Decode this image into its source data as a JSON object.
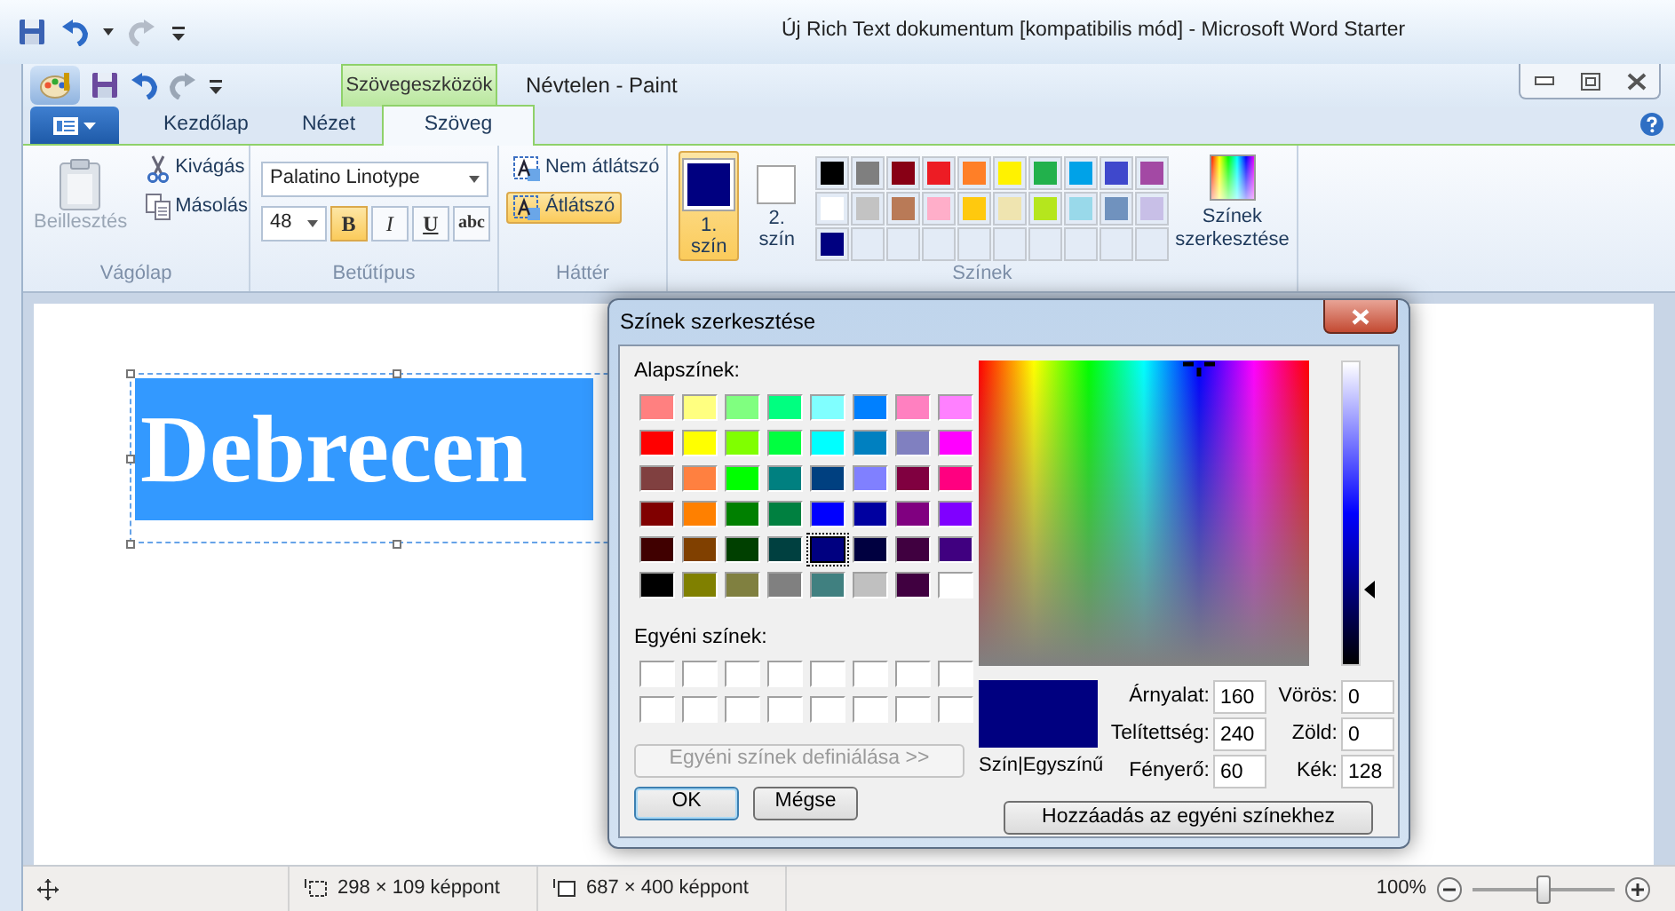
{
  "word_window": {
    "title": "Új Rich Text dokumentum [kompatibilis mód]  -  Microsoft Word Starter"
  },
  "paint_window": {
    "title": "Névtelen - Paint",
    "context_tab": "Szövegeszközök"
  },
  "ribbon_tabs": [
    {
      "label": "Kezdőlap",
      "selected": false
    },
    {
      "label": "Nézet",
      "selected": false
    },
    {
      "label": "Szöveg",
      "selected": true
    }
  ],
  "clipboard": {
    "label": "Vágólap",
    "paste": {
      "label": "Beillesztés",
      "disabled": true
    },
    "cut": "Kivágás",
    "copy": "Másolás"
  },
  "font": {
    "label": "Betűtípus",
    "family": "Palatino Linotype",
    "size": "48",
    "styles": [
      {
        "label": "B",
        "kind": "bold",
        "selected": true
      },
      {
        "label": "I",
        "kind": "italic",
        "selected": false
      },
      {
        "label": "U",
        "kind": "underline",
        "selected": false
      },
      {
        "label": "abc",
        "kind": "strike",
        "selected": false
      }
    ]
  },
  "background": {
    "label": "Háttér",
    "options": [
      {
        "label": "Nem átlátszó",
        "selected": false
      },
      {
        "label": "Átlátszó",
        "selected": true
      }
    ]
  },
  "colors": {
    "label": "Színek",
    "edit_label": "Színek szerkesztése",
    "slots": [
      {
        "label": "1. szín",
        "color": "#000080",
        "selected": true
      },
      {
        "label": "2. szín",
        "color": "#ffffff",
        "selected": false
      }
    ],
    "palette": [
      {
        "color": "#000000"
      },
      {
        "color": "#7f7f7f"
      },
      {
        "color": "#880015"
      },
      {
        "color": "#ed1c24"
      },
      {
        "color": "#ff7f27"
      },
      {
        "color": "#fff200"
      },
      {
        "color": "#22b14c"
      },
      {
        "color": "#00a2e8"
      },
      {
        "color": "#3f48cc"
      },
      {
        "color": "#a349a4"
      },
      {
        "color": "#ffffff"
      },
      {
        "color": "#c3c3c3"
      },
      {
        "color": "#b97a57"
      },
      {
        "color": "#ffaec9"
      },
      {
        "color": "#ffc90e"
      },
      {
        "color": "#efe4b0"
      },
      {
        "color": "#b5e61d"
      },
      {
        "color": "#99d9ea"
      },
      {
        "color": "#7092be"
      },
      {
        "color": "#c8bfe7"
      }
    ],
    "recent": [
      {
        "color": "#000080"
      }
    ]
  },
  "canvas": {
    "text": "Debrecen",
    "color": "#3399ff"
  },
  "status_bar": {
    "selection_size": "298 × 109 képpont",
    "canvas_size": "687 × 400 képpont",
    "zoom": "100%",
    "zoom_slider": {
      "level": 0.5
    }
  },
  "dialog": {
    "title": "Színek szerkesztése",
    "basic_label": "Alapszínek:",
    "basic_colors": [
      {
        "color": "#ff8080",
        "selected": false
      },
      {
        "color": "#ffff80",
        "selected": false
      },
      {
        "color": "#80ff80",
        "selected": false
      },
      {
        "color": "#00ff80",
        "selected": false
      },
      {
        "color": "#80ffff",
        "selected": false
      },
      {
        "color": "#0080ff",
        "selected": false
      },
      {
        "color": "#ff80c0",
        "selected": false
      },
      {
        "color": "#ff80ff",
        "selected": false
      },
      {
        "color": "#ff0000",
        "selected": false
      },
      {
        "color": "#ffff00",
        "selected": false
      },
      {
        "color": "#80ff00",
        "selected": false
      },
      {
        "color": "#00ff40",
        "selected": false
      },
      {
        "color": "#00ffff",
        "selected": false
      },
      {
        "color": "#0080c0",
        "selected": false
      },
      {
        "color": "#8080c0",
        "selected": false
      },
      {
        "color": "#ff00ff",
        "selected": false
      },
      {
        "color": "#804040",
        "selected": false
      },
      {
        "color": "#ff8040",
        "selected": false
      },
      {
        "color": "#00ff00",
        "selected": false
      },
      {
        "color": "#008080",
        "selected": false
      },
      {
        "color": "#004080",
        "selected": false
      },
      {
        "color": "#8080ff",
        "selected": false
      },
      {
        "color": "#800040",
        "selected": false
      },
      {
        "color": "#ff0080",
        "selected": false
      },
      {
        "color": "#800000",
        "selected": false
      },
      {
        "color": "#ff8000",
        "selected": false
      },
      {
        "color": "#008000",
        "selected": false
      },
      {
        "color": "#008040",
        "selected": false
      },
      {
        "color": "#0000ff",
        "selected": false
      },
      {
        "color": "#0000a0",
        "selected": false
      },
      {
        "color": "#800080",
        "selected": false
      },
      {
        "color": "#8000ff",
        "selected": false
      },
      {
        "color": "#400000",
        "selected": false
      },
      {
        "color": "#804000",
        "selected": false
      },
      {
        "color": "#004000",
        "selected": false
      },
      {
        "color": "#004040",
        "selected": false
      },
      {
        "color": "#000080",
        "selected": true
      },
      {
        "color": "#000040",
        "selected": false
      },
      {
        "color": "#400040",
        "selected": false
      },
      {
        "color": "#400080",
        "selected": false
      },
      {
        "color": "#000000",
        "selected": false
      },
      {
        "color": "#808000",
        "selected": false
      },
      {
        "color": "#808040",
        "selected": false
      },
      {
        "color": "#808080",
        "selected": false
      },
      {
        "color": "#408080",
        "selected": false
      },
      {
        "color": "#c0c0c0",
        "selected": false
      },
      {
        "color": "#400040",
        "selected": false
      },
      {
        "color": "#ffffff",
        "selected": false
      }
    ],
    "custom_label": "Egyéni színek:",
    "custom_colors": [
      {
        "color": "#ffffff"
      },
      {
        "color": "#ffffff"
      },
      {
        "color": "#ffffff"
      },
      {
        "color": "#ffffff"
      },
      {
        "color": "#ffffff"
      },
      {
        "color": "#ffffff"
      },
      {
        "color": "#ffffff"
      },
      {
        "color": "#ffffff"
      },
      {
        "color": "#ffffff"
      },
      {
        "color": "#ffffff"
      },
      {
        "color": "#ffffff"
      },
      {
        "color": "#ffffff"
      },
      {
        "color": "#ffffff"
      },
      {
        "color": "#ffffff"
      },
      {
        "color": "#ffffff"
      },
      {
        "color": "#ffffff"
      }
    ],
    "define_button": {
      "label": "Egyéni színek definiálása >>",
      "disabled": true
    },
    "ok": "OK",
    "cancel": "Mégse",
    "preview": {
      "color": "#000080",
      "label": "Szín|Egyszínű"
    },
    "luminance": {
      "level": 0.25
    },
    "fields": [
      {
        "label": "Árnyalat:",
        "value": "160"
      },
      {
        "label": "Telítettség:",
        "value": "240"
      },
      {
        "label": "Fényerő:",
        "value": "60"
      }
    ],
    "rgb_fields": [
      {
        "label": "Vörös:",
        "value": "0"
      },
      {
        "label": "Zöld:",
        "value": "0"
      },
      {
        "label": "Kék:",
        "value": "128"
      }
    ],
    "add_button": "Hozzáadás az egyéni színekhez"
  }
}
